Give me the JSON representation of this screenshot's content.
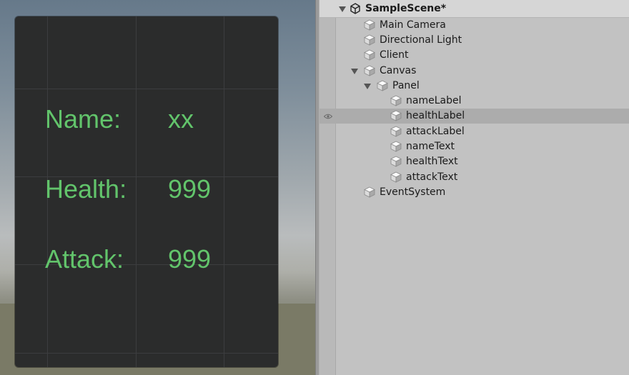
{
  "scene_view": {
    "panel": {
      "name_label": "Name:",
      "name_value": "xx",
      "health_label": "Health:",
      "health_value": "999",
      "attack_label": "Attack:",
      "attack_value": "999",
      "text_color": "#62c46b"
    }
  },
  "hierarchy": {
    "scene_name": "SampleScene*",
    "items": [
      {
        "label": "Main Camera"
      },
      {
        "label": "Directional Light"
      },
      {
        "label": "Client"
      },
      {
        "label": "Canvas"
      },
      {
        "label": "Panel"
      },
      {
        "label": "nameLabel"
      },
      {
        "label": "healthLabel"
      },
      {
        "label": "attackLabel"
      },
      {
        "label": "nameText"
      },
      {
        "label": "healthText"
      },
      {
        "label": "attackText"
      },
      {
        "label": "EventSystem"
      }
    ]
  }
}
